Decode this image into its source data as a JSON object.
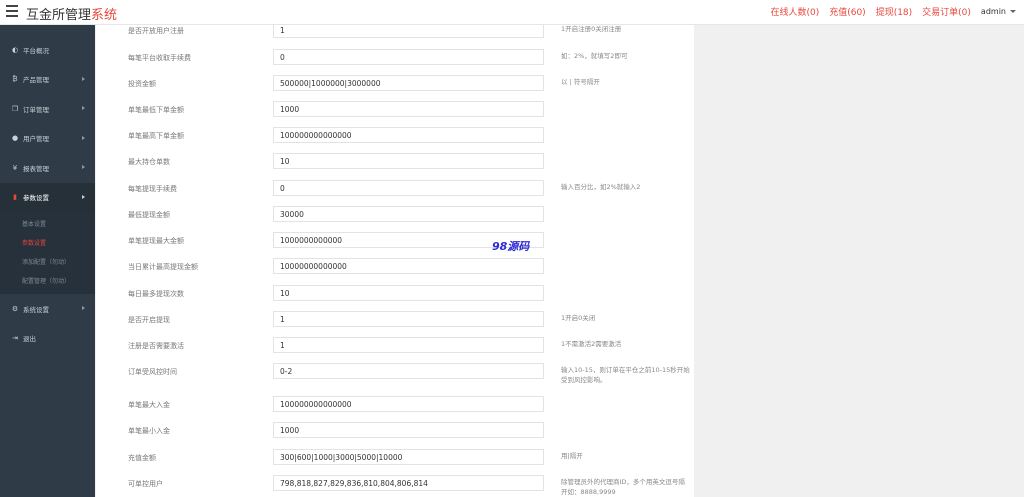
{
  "header": {
    "brand_main": "互金所管理",
    "brand_accent": "系统",
    "nav": [
      {
        "label": "在线人数(0)"
      },
      {
        "label": "充值(60)"
      },
      {
        "label": "提现(18)"
      },
      {
        "label": "交易订单(0)"
      }
    ],
    "user": "admin"
  },
  "sidebar": {
    "items": [
      {
        "label": "平台概况",
        "icon": "dashboard-icon"
      },
      {
        "label": "产品管理",
        "icon": "bitcoin-icon"
      },
      {
        "label": "订单管理",
        "icon": "copy-icon"
      },
      {
        "label": "用户管理",
        "icon": "user-icon"
      },
      {
        "label": "报表管理",
        "icon": "yen-icon"
      },
      {
        "label": "参数设置",
        "icon": "file-icon"
      }
    ],
    "submenu": [
      {
        "label": "基本设置"
      },
      {
        "label": "参数设置"
      },
      {
        "label": "添加配置（勿动）"
      },
      {
        "label": "配置管理（勿动）"
      }
    ],
    "bottom_items": [
      {
        "label": "系统设置",
        "icon": "cogs-icon"
      },
      {
        "label": "退出",
        "icon": "logout-icon"
      }
    ]
  },
  "form": {
    "rows": [
      {
        "label": "是否开放用户注册",
        "value": "1",
        "help": "1开启注册0关闭注册"
      },
      {
        "label": "每笔平台收取手续费",
        "value": "0",
        "help": "如：2%，就填写2即可"
      },
      {
        "label": "投资金额",
        "value": "500000|1000000|3000000",
        "help": "以 | 符号隔开"
      },
      {
        "label": "单笔最低下单金额",
        "value": "1000",
        "help": ""
      },
      {
        "label": "单笔最高下单金额",
        "value": "100000000000000",
        "help": ""
      },
      {
        "label": "最大持仓单数",
        "value": "10",
        "help": ""
      },
      {
        "label": "每笔提现手续费",
        "value": "0",
        "help": "输入百分比，如2%就输入2"
      },
      {
        "label": "最低提现金额",
        "value": "30000",
        "help": ""
      },
      {
        "label": "单笔提现最大金额",
        "value": "1000000000000",
        "help": ""
      },
      {
        "label": "当日累计最高提现金额",
        "value": "10000000000000",
        "help": ""
      },
      {
        "label": "每日最多提现次数",
        "value": "10",
        "help": ""
      },
      {
        "label": "是否开启提现",
        "value": "1",
        "help": "1开启0关闭"
      },
      {
        "label": "注册是否需要激活",
        "value": "1",
        "help": "1不需激活2需要激活"
      },
      {
        "label": "订单受风控时间",
        "value": "0-2",
        "help": "输入10-15，则订单在平仓之前10-15秒开始受到风控影响。"
      },
      {
        "label": "单笔最大入金",
        "value": "100000000000000",
        "help": ""
      },
      {
        "label": "单笔最小入金",
        "value": "1000",
        "help": ""
      },
      {
        "label": "充值金额",
        "value": "300|600|1000|3000|5000|10000",
        "help": "用|隔开"
      },
      {
        "label": "可单控用户",
        "value": "798,818,827,829,836,810,804,806,814",
        "help": "除管理员外的代理商ID，多个用英文逗号隔开如：8888,9999"
      }
    ]
  },
  "watermark": "98源码"
}
